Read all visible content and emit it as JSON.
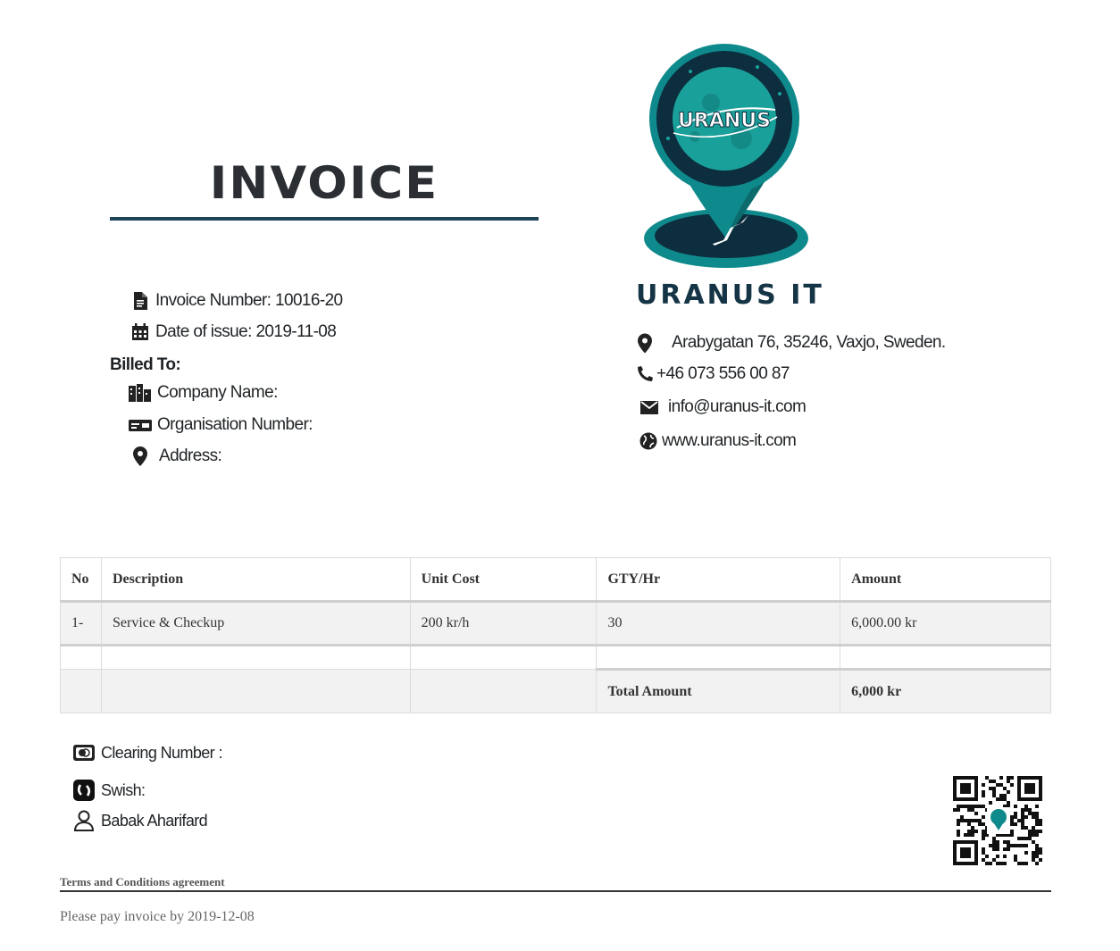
{
  "header": {
    "title": "INVOICE"
  },
  "invoice": {
    "number_label": "Invoice Number: 10016-20",
    "date_label": "Date of issue: 2019-11-08"
  },
  "billed_to": {
    "heading": "Billed To:",
    "company_label": "Company Name:",
    "org_label": "Organisation Number:",
    "address_label": "Address:"
  },
  "company": {
    "logo_text": "URANUS",
    "name": "URANUS IT",
    "address": "Arabygatan 76, 35246, Vaxjo, Sweden.",
    "phone": "+46 073 556 00 87",
    "email": "info@uranus-it.com",
    "website": "www.uranus-it.com",
    "brand_color": "#0f8a8c",
    "dark_color": "#153446"
  },
  "table": {
    "headers": [
      "No",
      "Description",
      "Unit Cost",
      "GTY/Hr",
      "Amount"
    ],
    "rows": [
      [
        "1-",
        "Service & Checkup",
        "200 kr/h",
        "30",
        "6,000.00 kr"
      ]
    ],
    "total_label": "Total Amount",
    "total_value": "6,000 kr"
  },
  "payment": {
    "clearing_label": "Clearing Number :",
    "swish_label": "Swish:",
    "person": "Babak Aharifard"
  },
  "footer": {
    "terms": "Terms and Conditions agreement",
    "due": "Please pay invoice by 2019-12-08"
  }
}
